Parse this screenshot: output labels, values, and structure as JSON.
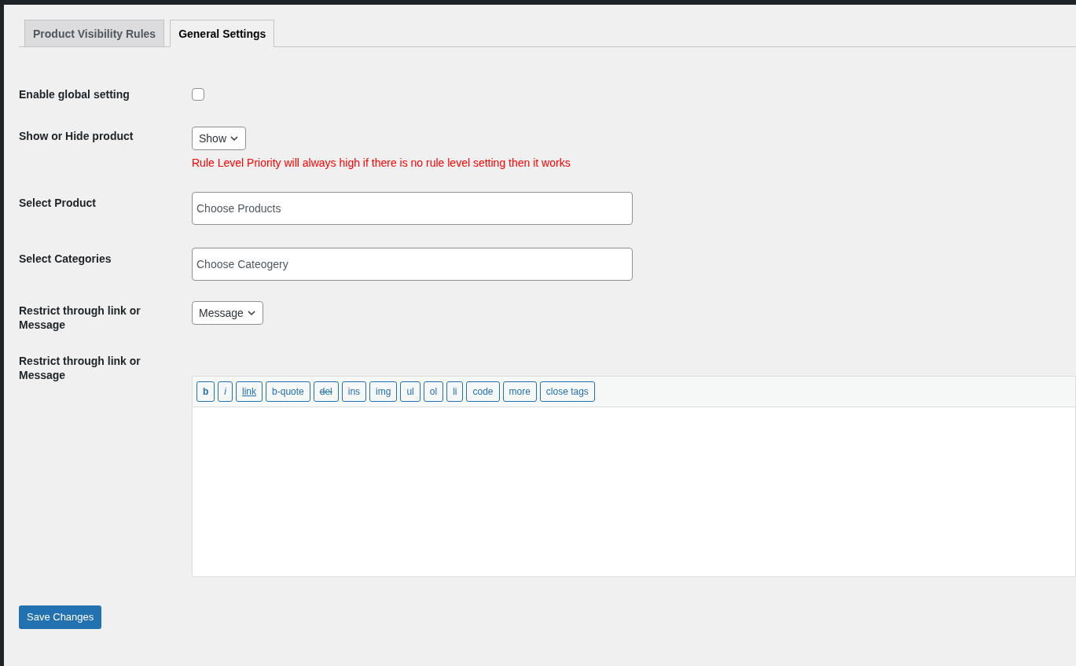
{
  "tabs": [
    {
      "label": "Product Visibility Rules",
      "selected": false
    },
    {
      "label": "General Settings",
      "selected": true
    }
  ],
  "rows": [
    {
      "kind": "checkbox",
      "label": "Enable global setting",
      "checked": false
    },
    {
      "kind": "select",
      "label": "Show or Hide product",
      "value": "Show",
      "note": "Rule Level Priority will always high if there is no rule level setting then it works"
    },
    {
      "kind": "text",
      "label": "Select Product",
      "placeholder": "Choose Products"
    },
    {
      "kind": "text",
      "label": "Select Categories",
      "placeholder": "Choose Cateogery"
    },
    {
      "kind": "select",
      "label": "Restrict through link or Message",
      "value": "Message"
    },
    {
      "kind": "editor",
      "label": "Restrict through link or Message",
      "buttons": [
        {
          "label": "b",
          "kind": "bold"
        },
        {
          "label": "i",
          "kind": "italic"
        },
        {
          "label": "link",
          "kind": "underline"
        },
        {
          "label": "b-quote",
          "kind": "plain"
        },
        {
          "label": "del",
          "kind": "strike"
        },
        {
          "label": "ins",
          "kind": "plain"
        },
        {
          "label": "img",
          "kind": "plain"
        },
        {
          "label": "ul",
          "kind": "plain"
        },
        {
          "label": "ol",
          "kind": "plain"
        },
        {
          "label": "li",
          "kind": "plain"
        },
        {
          "label": "code",
          "kind": "plain"
        },
        {
          "label": "more",
          "kind": "plain"
        },
        {
          "label": "close tags",
          "kind": "plain"
        }
      ]
    }
  ],
  "save_button": "Save Changes"
}
